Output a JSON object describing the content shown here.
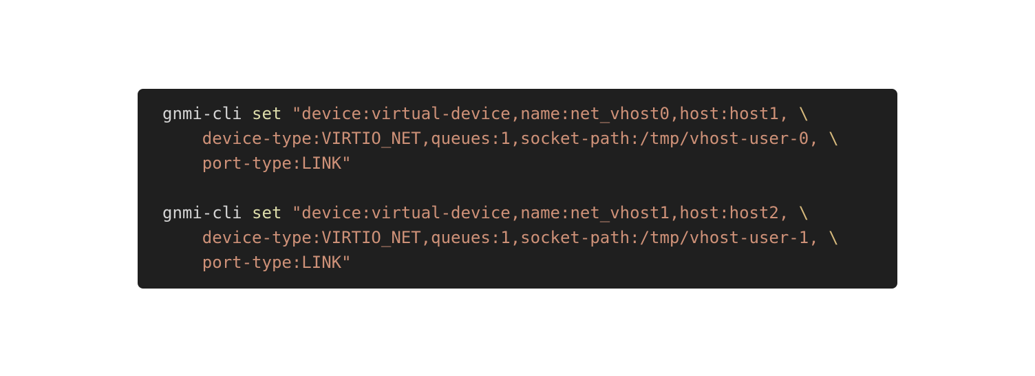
{
  "code_block": {
    "language": "shell",
    "colors": {
      "background": "#1f1f1f",
      "command": "#d4d4d4",
      "keyword": "#dcdcaa",
      "string": "#ce9178",
      "continuation": "#d7ba7d"
    },
    "commands": [
      {
        "command": "gnmi-cli",
        "subcommand": "set",
        "line1": "\"device:virtual-device,name:net_vhost0,host:host1,",
        "line2": "device-type:VIRTIO_NET,queues:1,socket-path:/tmp/vhost-user-0,",
        "line3": "port-type:LINK\"",
        "continuation": "\\"
      },
      {
        "command": "gnmi-cli",
        "subcommand": "set",
        "line1": "\"device:virtual-device,name:net_vhost1,host:host2,",
        "line2": "device-type:VIRTIO_NET,queues:1,socket-path:/tmp/vhost-user-1,",
        "line3": "port-type:LINK\"",
        "continuation": "\\"
      }
    ]
  }
}
